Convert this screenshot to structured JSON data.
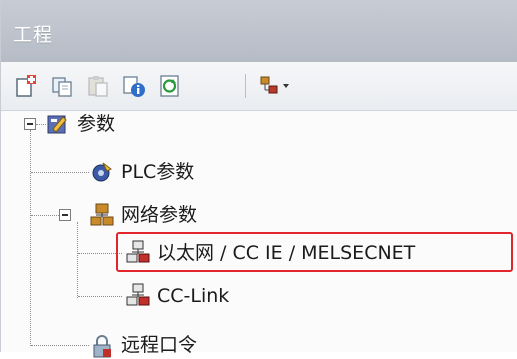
{
  "panel": {
    "title": "工程"
  },
  "toolbar": {
    "buttons": [
      {
        "icon": "new-icon"
      },
      {
        "icon": "copy-icon"
      },
      {
        "icon": "paste-icon"
      },
      {
        "icon": "properties-icon"
      },
      {
        "icon": "refresh-icon"
      },
      {
        "icon": "network-dropdown-icon"
      }
    ]
  },
  "tree": {
    "root": {
      "label": "参数",
      "icon": "parameter-icon"
    },
    "plc": {
      "label": "PLC参数",
      "icon": "plc-parameter-icon"
    },
    "network": {
      "label": "网络参数",
      "icon": "network-parameter-icon"
    },
    "ethernet": {
      "label": "以太网 / CC IE / MELSECNET",
      "icon": "network-node-icon",
      "highlighted": true
    },
    "cclink": {
      "label": "CC-Link",
      "icon": "network-node-icon"
    },
    "remote": {
      "label": "远程口令",
      "icon": "lock-icon"
    }
  },
  "colors": {
    "highlight": "#e0252b",
    "titlebar": "#bcc2cb"
  }
}
